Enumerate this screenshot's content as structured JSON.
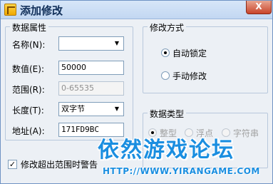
{
  "window": {
    "title": "添加修改",
    "close_label": "X"
  },
  "attributes": {
    "legend": "数据属性",
    "name": {
      "label": "名称(N):",
      "value": ""
    },
    "value": {
      "label": "数值(E):",
      "value": "50000"
    },
    "range": {
      "label": "范围(R):",
      "value": "0-65535"
    },
    "length": {
      "label": "长度(T):",
      "value": "双字节"
    },
    "address": {
      "label": "地址(A):",
      "value": "171FD9BC"
    }
  },
  "mode": {
    "legend": "修改方式",
    "options": [
      {
        "label": "自动锁定",
        "checked": true
      },
      {
        "label": "手动修改",
        "checked": false
      }
    ]
  },
  "data_type": {
    "legend": "数据类型",
    "options": [
      {
        "label": "整型",
        "checked": true
      },
      {
        "label": "浮点",
        "checked": false
      },
      {
        "label": "字符串",
        "checked": false
      }
    ]
  },
  "warning": {
    "label": "修改超出范围时警告",
    "checked": true,
    "check_glyph": "✓"
  },
  "watermark": {
    "text": "依然游戏论坛",
    "url": "HTTP://WWW.YIRANGAME.COM"
  }
}
